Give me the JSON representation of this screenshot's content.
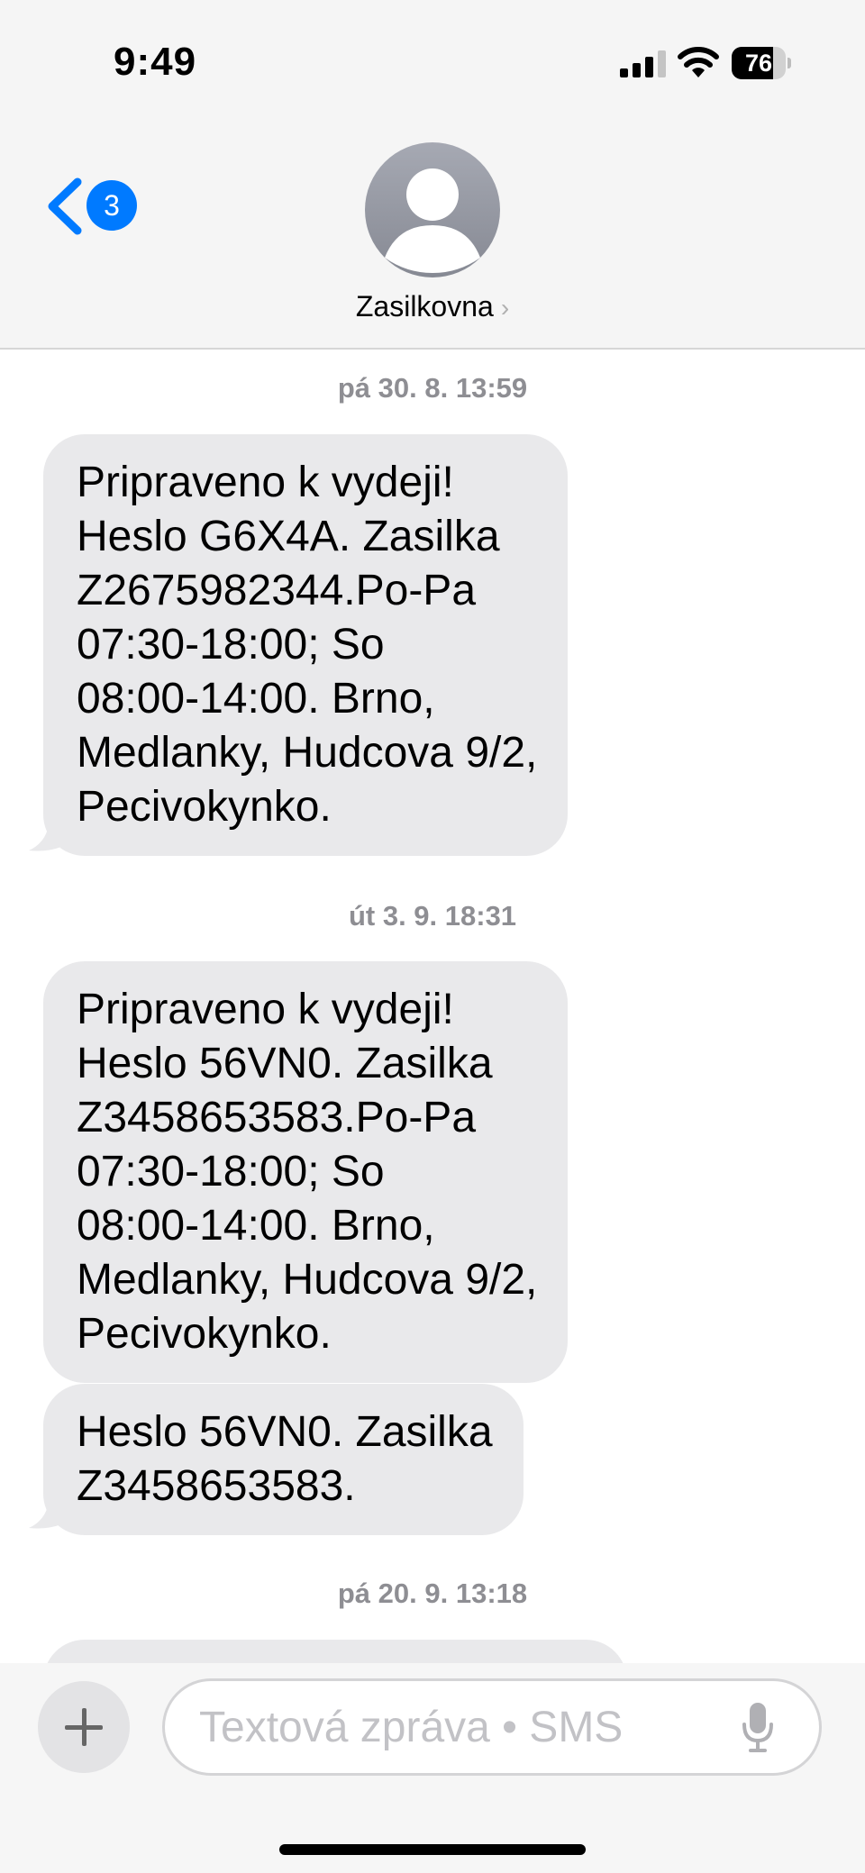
{
  "status_bar": {
    "time": "9:49",
    "battery_percent": "76",
    "battery_level": 0.76
  },
  "nav": {
    "unread_count": "3",
    "contact_name": "Zasilkovna",
    "contact_chevron": "›"
  },
  "messages": [
    {
      "timestamp": "pá 30. 8. 13:59",
      "bubbles": [
        {
          "lines": [
            "Pripraveno k vydeji!",
            "Heslo G6X4A. Zasilka",
            "Z2675982344.Po-Pa",
            "07:30-18:00; So",
            "08:00-14:00. Brno,",
            "Medlanky, Hudcova 9/2,",
            "Pecivokynko."
          ]
        }
      ]
    },
    {
      "timestamp": "út 3. 9. 18:31",
      "bubbles": [
        {
          "lines": [
            "Pripraveno k vydeji!",
            "Heslo 56VN0. Zasilka",
            "Z3458653583.Po-Pa",
            "07:30-18:00; So",
            "08:00-14:00. Brno,",
            "Medlanky, Hudcova 9/2,",
            "Pecivokynko."
          ]
        },
        {
          "lines": [
            "Heslo 56VN0. Zasilka",
            "Z3458653583."
          ]
        }
      ]
    },
    {
      "timestamp": "pá 20. 9. 13:18",
      "bubbles": []
    }
  ],
  "composer": {
    "placeholder": "Textová zpráva • SMS"
  },
  "icons": {
    "back": "chevron-left-icon",
    "avatar": "person-silhouette-icon",
    "signal": "cellular-signal-icon",
    "wifi": "wifi-icon",
    "battery": "battery-icon",
    "plus": "plus-icon",
    "mic": "microphone-icon"
  },
  "colors": {
    "accent": "#007aff",
    "bubble_incoming": "#e9e9eb",
    "timestamp": "#8e8e93"
  }
}
